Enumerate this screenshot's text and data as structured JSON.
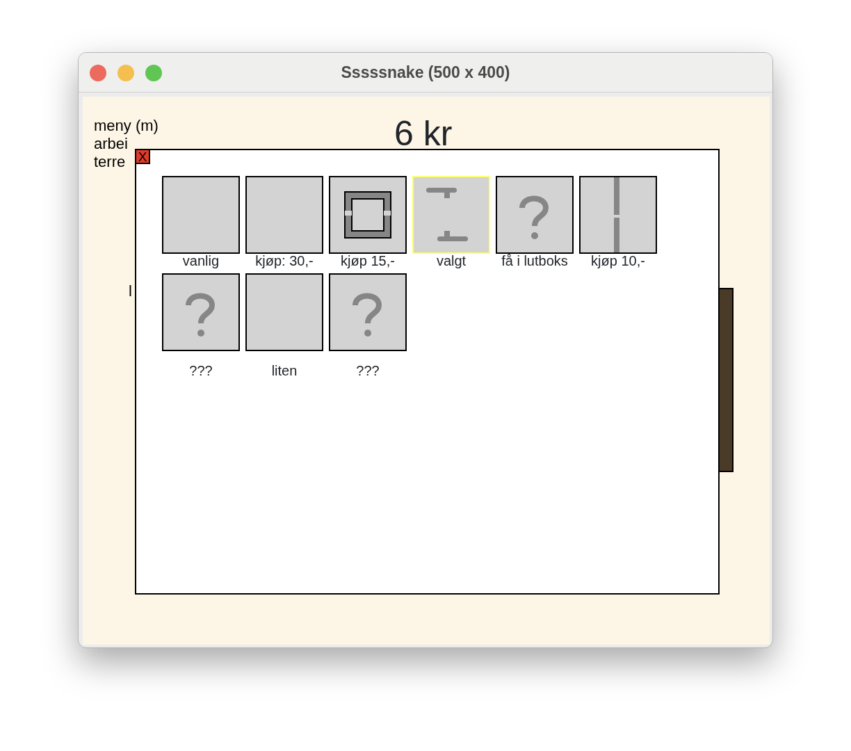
{
  "window": {
    "title": "Sssssnake (500 x 400)"
  },
  "menu_lines": [
    "meny (m)",
    "arbei",
    "terre"
  ],
  "stray_letter": "l",
  "money": "6 kr",
  "dialog": {
    "close": "X",
    "skins": [
      {
        "label": "vanlig",
        "kind": "blank",
        "selected": false
      },
      {
        "label": "kjøp: 30,-",
        "kind": "blank",
        "selected": false
      },
      {
        "label": "kjøp 15,-",
        "kind": "frame",
        "selected": false
      },
      {
        "label": "valgt",
        "kind": "pipes",
        "selected": true
      },
      {
        "label": "få i lutboks",
        "kind": "question",
        "selected": false
      },
      {
        "label": "kjøp 10,-",
        "kind": "wall",
        "selected": false
      },
      {
        "label": "???",
        "kind": "question",
        "selected": false
      },
      {
        "label": "liten",
        "kind": "blank",
        "selected": false
      },
      {
        "label": "???",
        "kind": "question",
        "selected": false
      }
    ]
  }
}
